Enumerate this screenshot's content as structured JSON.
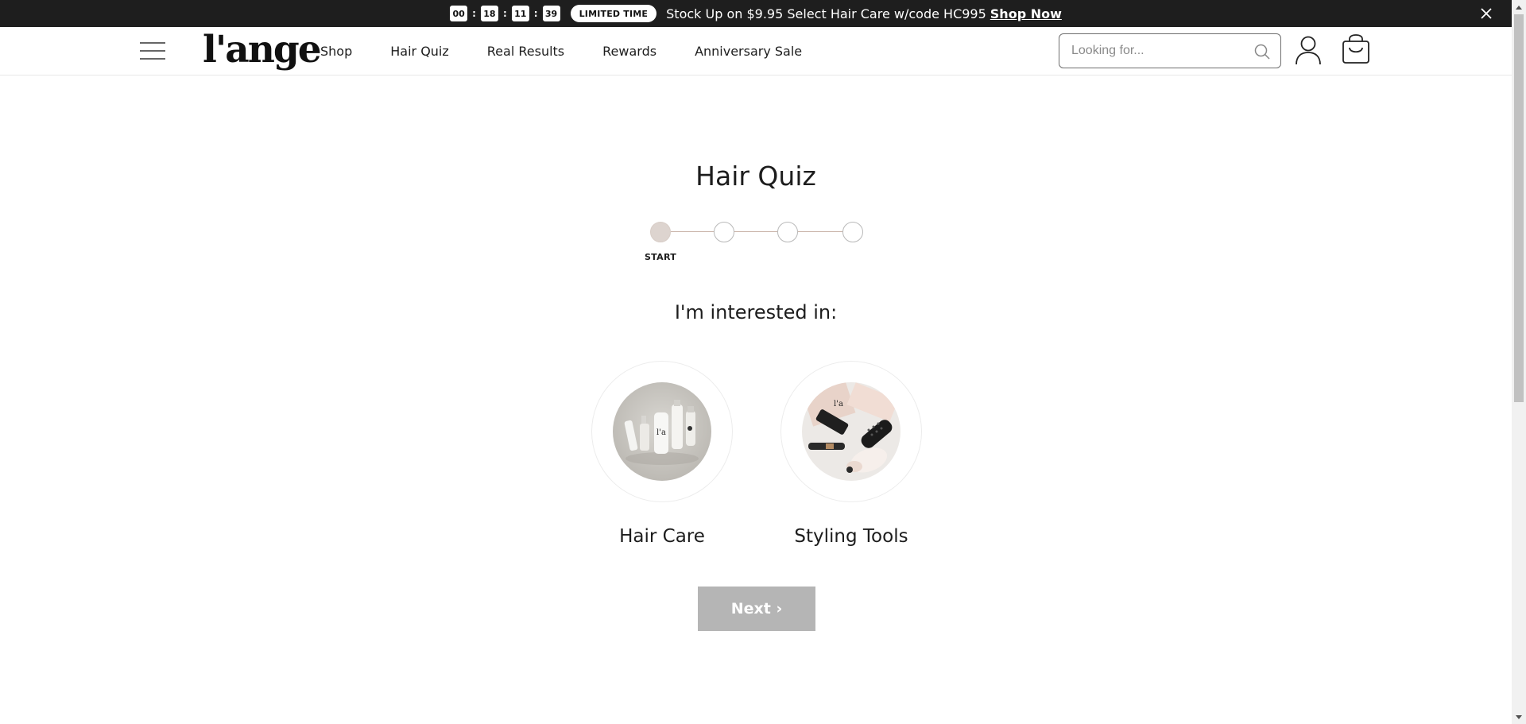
{
  "announcement": {
    "timer": {
      "hours": "00",
      "minutes": "18",
      "seconds": "11",
      "frames": "39",
      "separator": ":"
    },
    "badge": "LIMITED TIME",
    "text": "Stock Up on $9.95 Select Hair Care w/code HC995",
    "link": "Shop Now"
  },
  "header": {
    "logo": "l'ange",
    "nav": [
      "Shop",
      "Hair Quiz",
      "Real Results",
      "Rewards",
      "Anniversary Sale"
    ],
    "search_placeholder": "Looking for..."
  },
  "quiz": {
    "title": "Hair Quiz",
    "step_label": "START",
    "current_step": 1,
    "total_steps": 4,
    "question": "I'm interested in:",
    "options": [
      {
        "label": "Hair Care",
        "icon": "hair-care-products-image"
      },
      {
        "label": "Styling Tools",
        "icon": "styling-tools-image"
      }
    ],
    "next_label": "Next ›"
  },
  "colors": {
    "announcement_bg": "#1e1e1e",
    "step_active": "#ddd4cf",
    "step_line": "#c9b3a8",
    "next_disabled": "#b5b5b5"
  }
}
